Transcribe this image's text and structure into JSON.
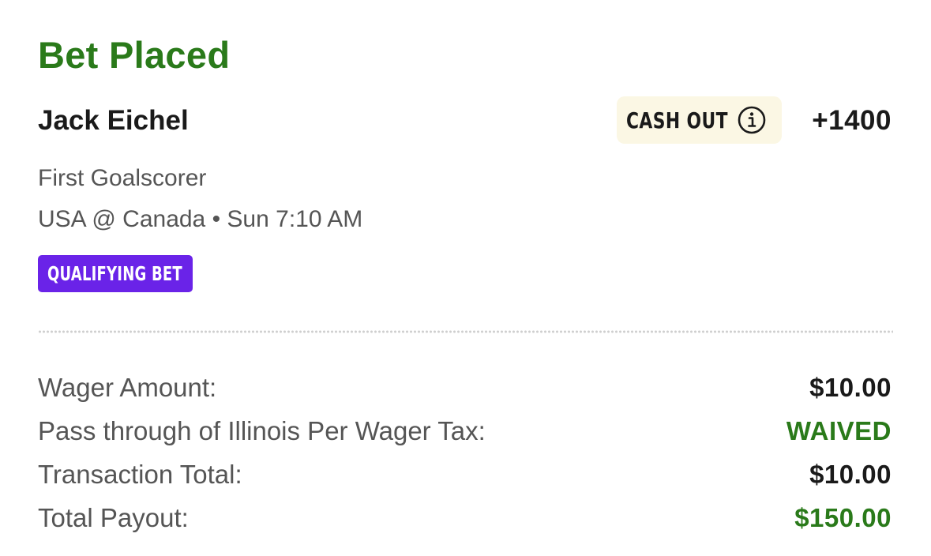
{
  "header": {
    "title": "Bet Placed"
  },
  "bet": {
    "player": "Jack Eichel",
    "cash_out_label": "CASH OUT",
    "odds": "+1400",
    "market": "First Goalscorer",
    "event": "USA @ Canada • Sun 7:10 AM",
    "badge": "QUALIFYING BET"
  },
  "summary": {
    "rows": [
      {
        "label": "Wager Amount:",
        "value": "$10.00",
        "value_color": "#1a1a1a"
      },
      {
        "label": "Pass through of Illinois Per Wager Tax:",
        "value": "WAIVED",
        "value_color": "#2a7a1a"
      },
      {
        "label": "Transaction Total:",
        "value": "$10.00",
        "value_color": "#1a1a1a"
      },
      {
        "label": "Total Payout:",
        "value": "$150.00",
        "value_color": "#2a7a1a"
      }
    ]
  },
  "icons": {
    "cash_out_info": "info-circle-icon"
  },
  "colors": {
    "title_green": "#2a7a1a",
    "cash_out_bg": "#fbf7e4",
    "badge_purple": "#6a23e8",
    "secondary_text": "#555555"
  }
}
